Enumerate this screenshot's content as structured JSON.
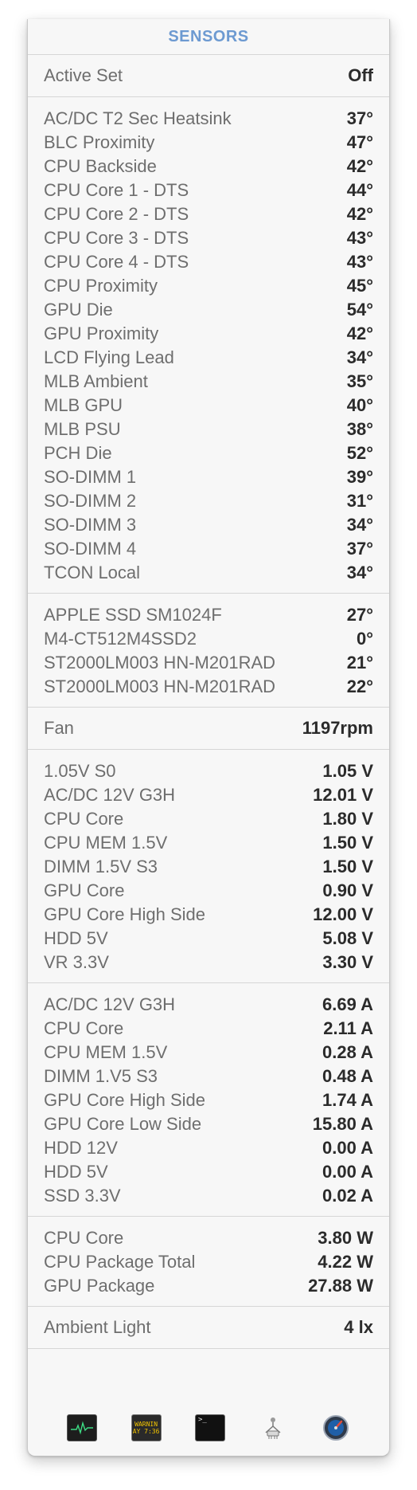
{
  "header": {
    "title": "SENSORS"
  },
  "active_set": {
    "label": "Active Set",
    "value": "Off"
  },
  "temperatures": [
    {
      "label": "AC/DC T2 Sec Heatsink",
      "value": "37°"
    },
    {
      "label": "BLC Proximity",
      "value": "47°"
    },
    {
      "label": "CPU Backside",
      "value": "42°"
    },
    {
      "label": "CPU Core 1 - DTS",
      "value": "44°"
    },
    {
      "label": "CPU Core 2 - DTS",
      "value": "42°"
    },
    {
      "label": "CPU Core 3 - DTS",
      "value": "43°"
    },
    {
      "label": "CPU Core 4 - DTS",
      "value": "43°"
    },
    {
      "label": "CPU Proximity",
      "value": "45°"
    },
    {
      "label": "GPU Die",
      "value": "54°"
    },
    {
      "label": "GPU Proximity",
      "value": "42°"
    },
    {
      "label": "LCD Flying Lead",
      "value": "34°"
    },
    {
      "label": "MLB Ambient",
      "value": "35°"
    },
    {
      "label": "MLB GPU",
      "value": "40°"
    },
    {
      "label": "MLB PSU",
      "value": "38°"
    },
    {
      "label": "PCH Die",
      "value": "52°"
    },
    {
      "label": "SO-DIMM 1",
      "value": "39°"
    },
    {
      "label": "SO-DIMM 2",
      "value": "31°"
    },
    {
      "label": "SO-DIMM 3",
      "value": "34°"
    },
    {
      "label": "SO-DIMM 4",
      "value": "37°"
    },
    {
      "label": "TCON Local",
      "value": "34°"
    }
  ],
  "drives": [
    {
      "label": "APPLE SSD SM1024F",
      "value": "27°"
    },
    {
      "label": "M4-CT512M4SSD2",
      "value": "0°"
    },
    {
      "label": "ST2000LM003 HN-M201RAD",
      "value": "21°"
    },
    {
      "label": "ST2000LM003 HN-M201RAD",
      "value": "22°"
    }
  ],
  "fan": {
    "label": "Fan",
    "value": "1197rpm"
  },
  "voltages": [
    {
      "label": "1.05V S0",
      "value": "1.05 V"
    },
    {
      "label": "AC/DC 12V G3H",
      "value": "12.01 V"
    },
    {
      "label": "CPU Core",
      "value": "1.80 V"
    },
    {
      "label": "CPU MEM 1.5V",
      "value": "1.50 V"
    },
    {
      "label": "DIMM 1.5V S3",
      "value": "1.50 V"
    },
    {
      "label": "GPU Core",
      "value": "0.90 V"
    },
    {
      "label": "GPU Core High Side",
      "value": "12.00 V"
    },
    {
      "label": "HDD 5V",
      "value": "5.08 V"
    },
    {
      "label": "VR 3.3V",
      "value": "3.30 V"
    }
  ],
  "currents": [
    {
      "label": "AC/DC 12V G3H",
      "value": "6.69 A"
    },
    {
      "label": "CPU Core",
      "value": "2.11 A"
    },
    {
      "label": "CPU MEM 1.5V",
      "value": "0.28 A"
    },
    {
      "label": "DIMM 1.V5 S3",
      "value": "0.48 A"
    },
    {
      "label": "GPU Core High Side",
      "value": "1.74 A"
    },
    {
      "label": "GPU Core Low Side",
      "value": "15.80 A"
    },
    {
      "label": "HDD 12V",
      "value": "0.00 A"
    },
    {
      "label": "HDD 5V",
      "value": "0.00 A"
    },
    {
      "label": "SSD 3.3V",
      "value": "0.02 A"
    }
  ],
  "power": [
    {
      "label": "CPU Core",
      "value": "3.80 W"
    },
    {
      "label": "CPU Package Total",
      "value": "4.22 W"
    },
    {
      "label": "GPU Package",
      "value": "27.88 W"
    }
  ],
  "ambient_light": {
    "label": "Ambient Light",
    "value": "4 lx"
  },
  "footer": {
    "console_icon_text": [
      "WARNIN",
      "AY 7:36"
    ],
    "terminal_icon_text": ">_",
    "icons": [
      "activity-monitor-icon",
      "console-icon",
      "terminal-icon",
      "system-information-icon",
      "disk-utility-icon"
    ]
  }
}
